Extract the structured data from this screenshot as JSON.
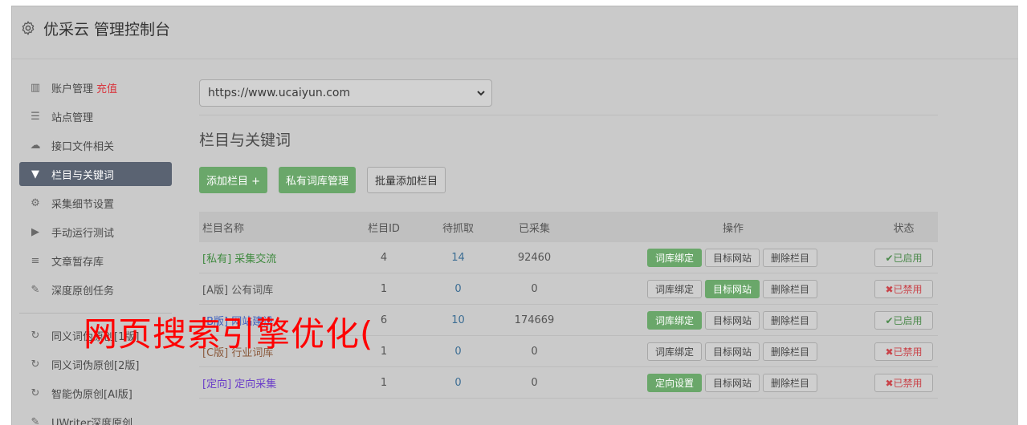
{
  "app": {
    "title": "优采云 管理控制台"
  },
  "sidebar": {
    "items": [
      {
        "label": "账户管理",
        "extra": "充值",
        "icon": "bar-chart-icon",
        "glyph": "▥"
      },
      {
        "label": "站点管理",
        "icon": "server-icon",
        "glyph": "☰"
      },
      {
        "label": "接口文件相关",
        "icon": "cloud-upload-icon",
        "glyph": "☁"
      },
      {
        "label": "栏目与关键词",
        "icon": "filter-icon",
        "glyph": "▼",
        "active": true
      },
      {
        "label": "采集细节设置",
        "icon": "cogs-icon",
        "glyph": "⚙"
      },
      {
        "label": "手动运行测试",
        "icon": "play-circle-icon",
        "glyph": "▶"
      },
      {
        "label": "文章暂存库",
        "icon": "database-icon",
        "glyph": "≡"
      },
      {
        "label": "深度原创任务",
        "icon": "edit-icon",
        "glyph": "✎"
      }
    ],
    "items2": [
      {
        "label": "同义词伪原创[1版]",
        "icon": "refresh-icon",
        "glyph": "↻"
      },
      {
        "label": "同义词伪原创[2版]",
        "icon": "refresh-icon",
        "glyph": "↻"
      },
      {
        "label": "智能伪原创[AI版]",
        "icon": "refresh-icon",
        "glyph": "↻"
      },
      {
        "label": "UWriter深度原创",
        "icon": "edit-icon",
        "glyph": "✎"
      }
    ]
  },
  "main": {
    "site_select": "https://www.ucaiyun.com",
    "section_title": "栏目与关键词",
    "buttons": {
      "add": "添加栏目 +",
      "private_lib": "私有词库管理",
      "batch_add": "批量添加栏目"
    },
    "table": {
      "headers": {
        "name": "栏目名称",
        "id": "栏目ID",
        "wait": "待抓取",
        "collected": "已采集",
        "ops": "操作",
        "status": "状态"
      },
      "rows": [
        {
          "tag": "[私有]",
          "name": "采集交流",
          "id": "4",
          "wait": "14",
          "collected": "92460",
          "op1": "词库绑定",
          "op2": "目标网站",
          "op3": "删除栏目",
          "status": "✔已启用"
        },
        {
          "tag": "[A版]",
          "name": "公有词库",
          "id": "1",
          "wait": "0",
          "collected": "0",
          "op1": "词库绑定",
          "op2": "目标网站",
          "op3": "删除栏目",
          "status": "✖已禁用"
        },
        {
          "tag": "[B版]",
          "name": "网站建设",
          "id": "6",
          "wait": "10",
          "collected": "174669",
          "op1": "词库绑定",
          "op2": "目标网站",
          "op3": "删除栏目",
          "status": "✔已启用"
        },
        {
          "tag": "[C版]",
          "name": "行业词库",
          "id": "1",
          "wait": "0",
          "collected": "0",
          "op1": "词库绑定",
          "op2": "目标网站",
          "op3": "删除栏目",
          "status": "✖已禁用"
        },
        {
          "tag": "[定向]",
          "name": "定向采集",
          "id": "1",
          "wait": "0",
          "collected": "0",
          "op1": "定向设置",
          "op2": "目标网站",
          "op3": "删除栏目",
          "status": "✖已禁用"
        }
      ]
    }
  },
  "overlay": {
    "text": "网页搜索引擎优化("
  },
  "colors": {
    "green": "#6aa76a",
    "active_nav": "#5a6372",
    "red": "#d9363e",
    "link_green": "#3f8a3f",
    "link_blue": "#3c5fbf",
    "link_purple": "#6a3cc9"
  }
}
